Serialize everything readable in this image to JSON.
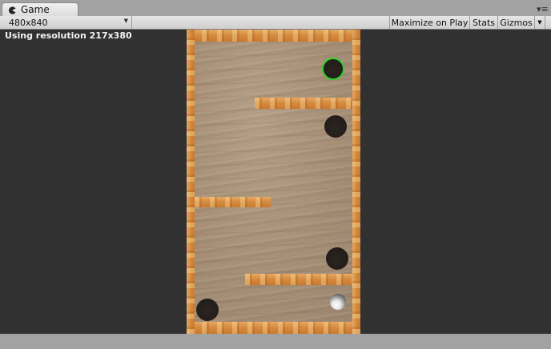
{
  "tab": {
    "title": "Game",
    "icon": "pacman-icon"
  },
  "window": {
    "menu_icon": "panel-menu-icon",
    "menu_glyph": "▾≡"
  },
  "toolbar": {
    "resolution": "480x840",
    "maximize_label": "Maximize on Play",
    "stats_label": "Stats",
    "gizmos_label": "Gizmos",
    "dropdown_arrow": "▼"
  },
  "viewport": {
    "resolution_text": "Using resolution 217x380"
  },
  "colors": {
    "goal_ring": "#2bd22b",
    "viewport_bg": "#313131",
    "editor_bg": "#a2a2a2"
  }
}
